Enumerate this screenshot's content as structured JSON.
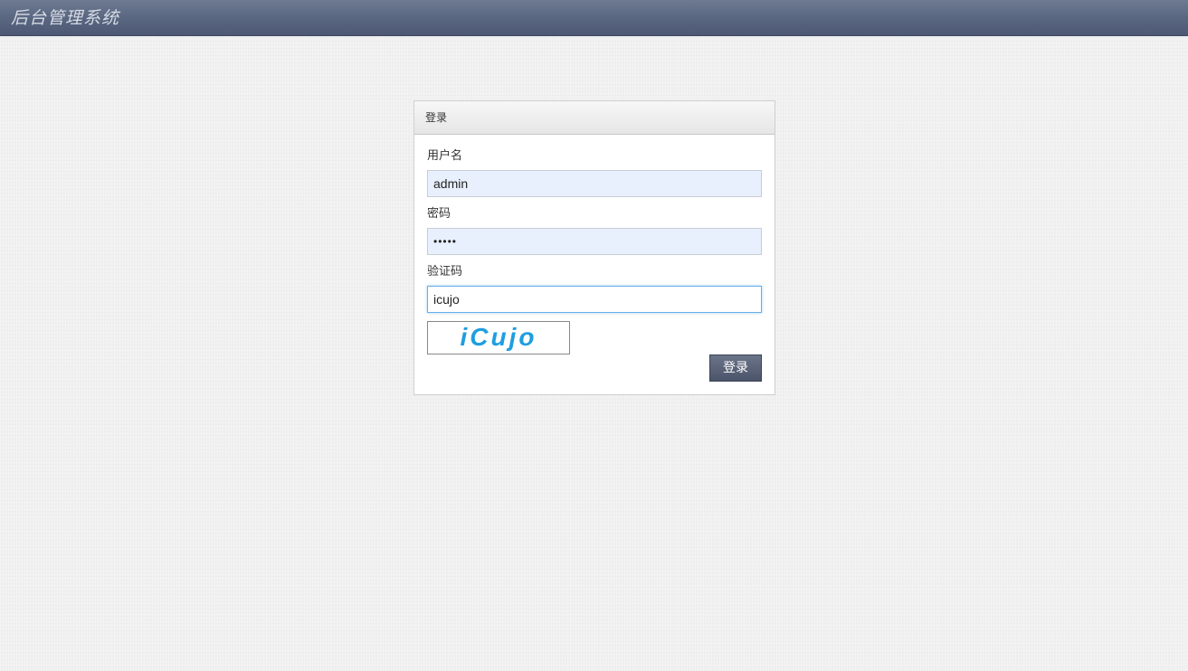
{
  "header": {
    "title": "后台管理系统"
  },
  "login_panel": {
    "heading": "登录",
    "username": {
      "label": "用户名",
      "value": "admin"
    },
    "password": {
      "label": "密码",
      "value": "•••••"
    },
    "captcha": {
      "label": "验证码",
      "value": "icujo",
      "image_text": "iCujo",
      "image_color": "#1e9ee0"
    },
    "submit_label": "登录"
  },
  "colors": {
    "header_bg": "#5a6781",
    "button_bg": "#4b546a",
    "focus_border": "#66afe9",
    "autofill_bg": "#e8f0fe"
  }
}
